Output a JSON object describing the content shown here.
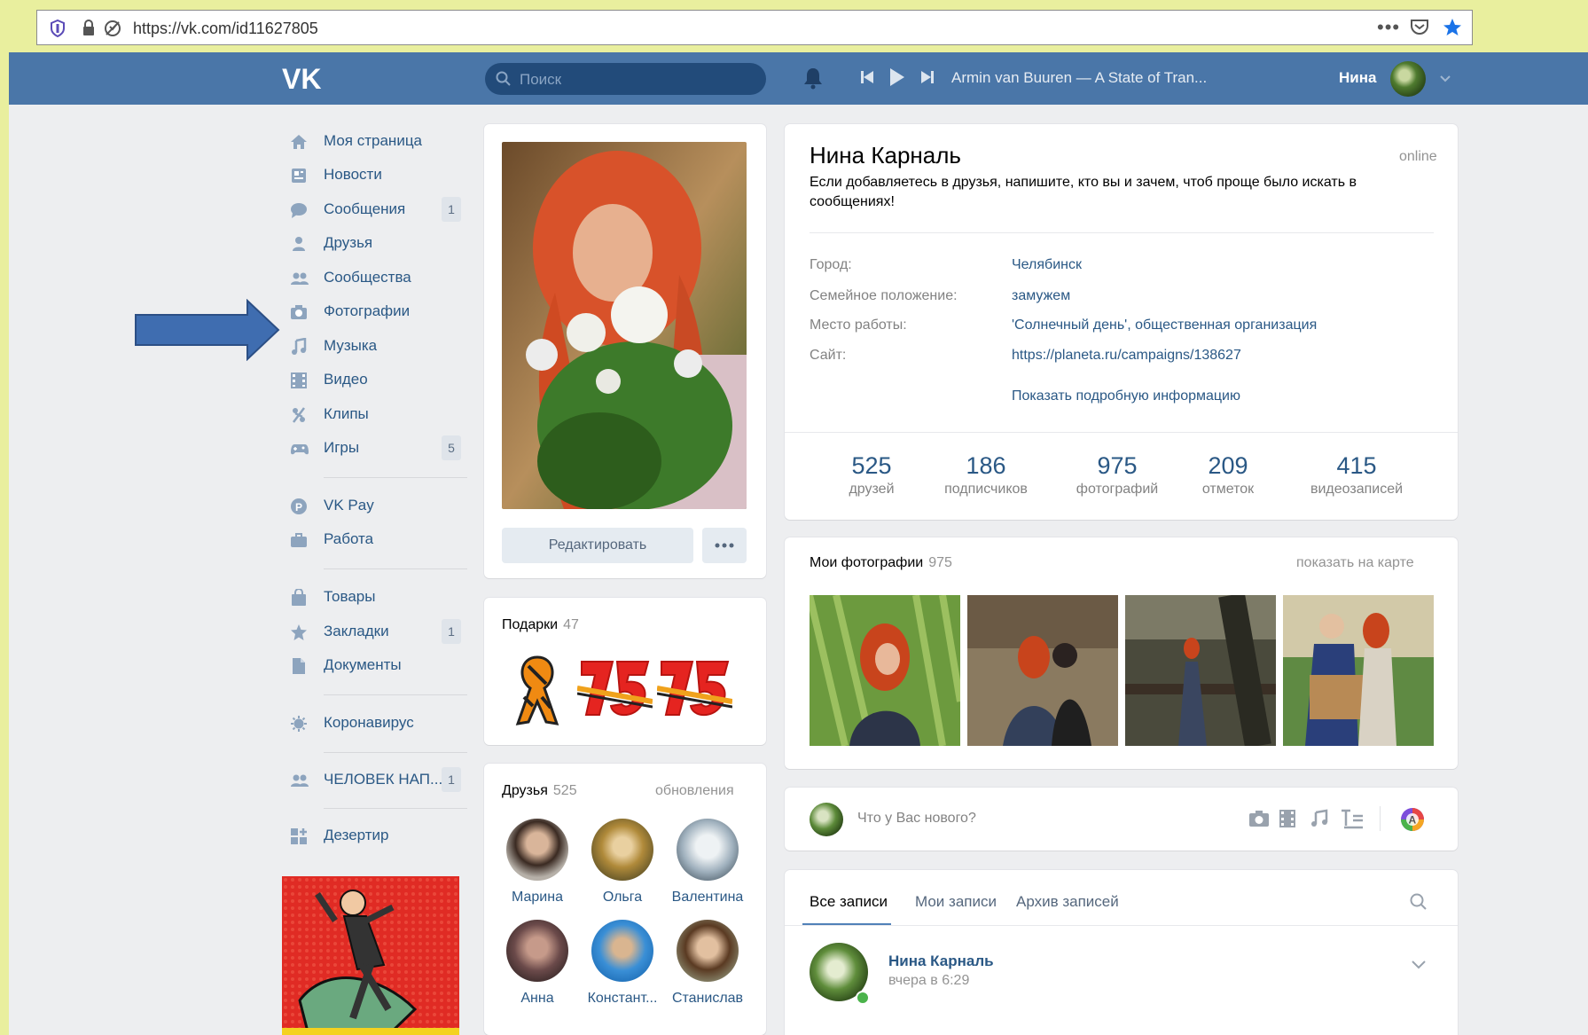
{
  "browser": {
    "url": "https://vk.com/id11627805"
  },
  "topbar": {
    "search_placeholder": "Поиск",
    "track": "Armin van Buuren — A State of Tran...",
    "user_name": "Нина"
  },
  "menu": {
    "items": [
      {
        "label": "Моя страница",
        "icon": "home-icon"
      },
      {
        "label": "Новости",
        "icon": "news-icon"
      },
      {
        "label": "Сообщения",
        "icon": "messages-icon",
        "count": "1"
      },
      {
        "label": "Друзья",
        "icon": "friend-icon"
      },
      {
        "label": "Сообщества",
        "icon": "communities-icon"
      },
      {
        "label": "Фотографии",
        "icon": "camera-icon"
      },
      {
        "label": "Музыка",
        "icon": "music-icon"
      },
      {
        "label": "Видео",
        "icon": "video-icon"
      },
      {
        "label": "Клипы",
        "icon": "clips-icon"
      },
      {
        "label": "Игры",
        "icon": "games-icon",
        "count": "5"
      },
      {
        "label": "VK Pay",
        "icon": "vkpay-icon"
      },
      {
        "label": "Работа",
        "icon": "work-icon"
      },
      {
        "label": "Товары",
        "icon": "bag-icon"
      },
      {
        "label": "Закладки",
        "icon": "star-icon",
        "count": "1"
      },
      {
        "label": "Документы",
        "icon": "document-icon"
      },
      {
        "label": "Коронавирус",
        "icon": "virus-icon"
      },
      {
        "label": "ЧЕЛОВЕК НАП...",
        "icon": "group-icon",
        "count": "1"
      },
      {
        "label": "Дезертир",
        "icon": "apps-icon"
      }
    ]
  },
  "profile": {
    "edit_button": "Редактировать",
    "name": "Нина Карналь",
    "online": "online",
    "status": "Если добавляетесь в друзья, напишите, кто вы и зачем, чтоб проще было искать в сообщениях!",
    "info": [
      {
        "key": "Город:",
        "value": "Челябинск"
      },
      {
        "key": "Семейное положение:",
        "value": "замужем"
      },
      {
        "key": "Место работы:",
        "value": "'Солнечный день', общественная организация"
      },
      {
        "key": "Сайт:",
        "value": "https://planeta.ru/campaigns/138627"
      }
    ],
    "show_more": "Показать подробную информацию",
    "stats": [
      {
        "number": "525",
        "label": "друзей"
      },
      {
        "number": "186",
        "label": "подписчиков"
      },
      {
        "number": "975",
        "label": "фотографий"
      },
      {
        "number": "209",
        "label": "отметок"
      },
      {
        "number": "415",
        "label": "видеозаписей"
      }
    ]
  },
  "gifts": {
    "title": "Подарки",
    "count": "47"
  },
  "friends": {
    "title": "Друзья",
    "count": "525",
    "updates": "обновления",
    "list": [
      "Марина",
      "Ольга",
      "Валентина",
      "Анна",
      "Констант...",
      "Станислав"
    ]
  },
  "photos": {
    "title": "Мои фотографии",
    "count": "975",
    "map_link": "показать на карте"
  },
  "newpost": {
    "placeholder": "Что у Вас нового?"
  },
  "wall": {
    "tabs": [
      "Все записи",
      "Мои записи",
      "Архив записей"
    ],
    "post_author": "Нина Карналь",
    "post_time": "вчера в 6:29"
  },
  "colors": {
    "accent": "#4a76a8",
    "link": "#2a5885",
    "page_bg": "#edeef0",
    "frame_bg": "#e9ef9e",
    "arrow": "#3f6db0"
  }
}
